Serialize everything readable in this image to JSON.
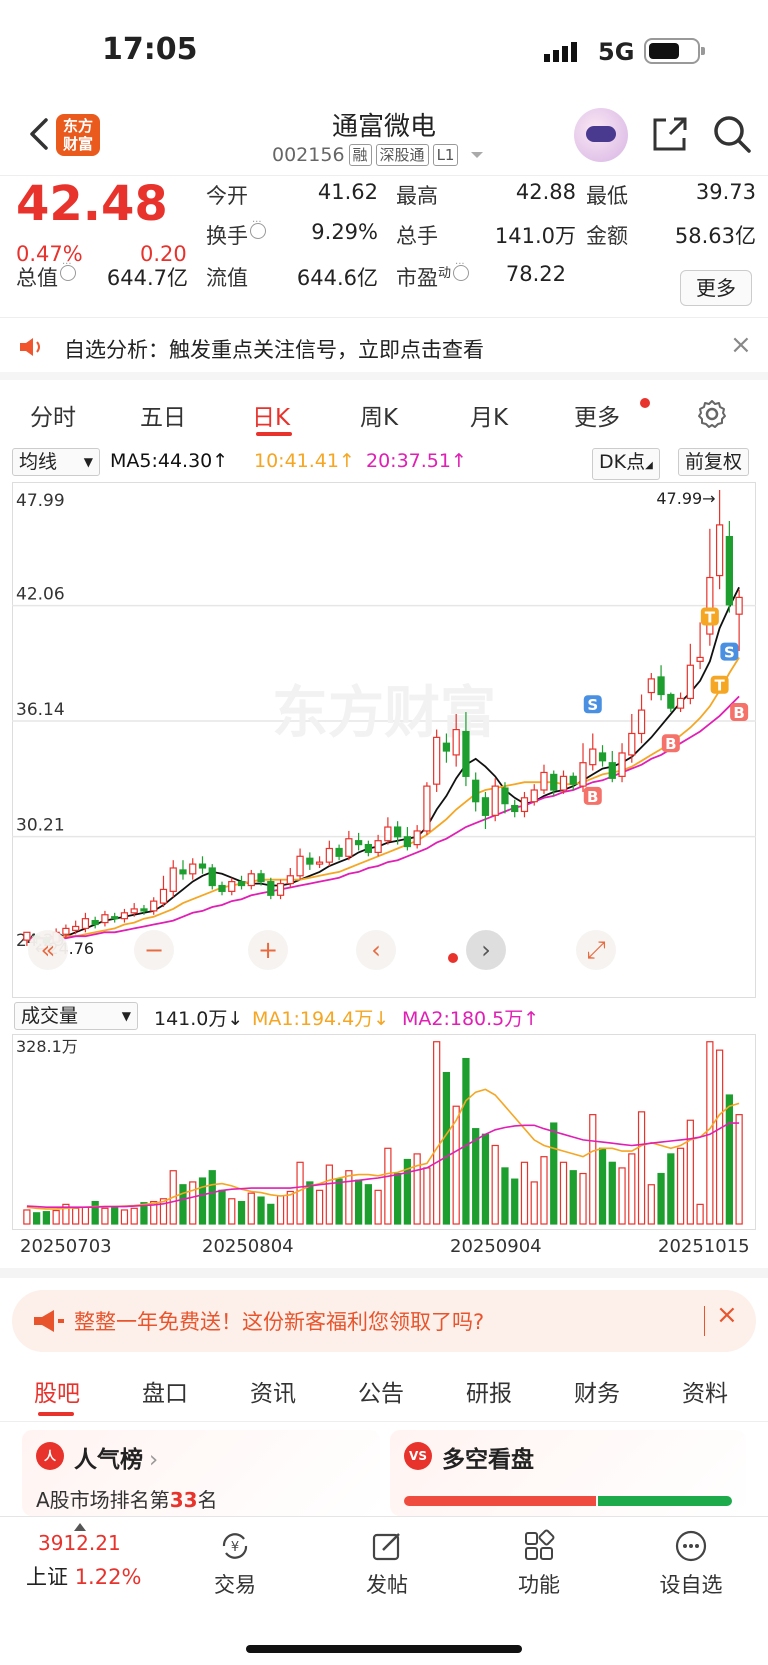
{
  "status": {
    "time": "17:05",
    "network": "5G"
  },
  "header": {
    "logo_text": "东方财富",
    "stock_name": "通富微电",
    "stock_code": "002156",
    "tags": [
      "融",
      "深股通",
      "L1"
    ]
  },
  "quote": {
    "price": "42.48",
    "change_pct": "0.47%",
    "change": "0.20",
    "fields": [
      {
        "label": "今开",
        "value": "41.62"
      },
      {
        "label": "最高",
        "value": "42.88"
      },
      {
        "label": "最低",
        "value": "39.73"
      },
      {
        "label": "换手",
        "value": "9.29%"
      },
      {
        "label": "总手",
        "value": "141.0万"
      },
      {
        "label": "金额",
        "value": "58.63亿"
      },
      {
        "label": "总值",
        "value": "644.7亿"
      },
      {
        "label": "流值",
        "value": "644.6亿"
      },
      {
        "label": "市盈",
        "label_sup": "动",
        "value": "78.22"
      }
    ],
    "more_label": "更多"
  },
  "alert": {
    "text": "自选分析：触发重点关注信号，立即点击查看",
    "close": "×"
  },
  "period_tabs": [
    "分时",
    "五日",
    "日K",
    "周K",
    "月K",
    "更多"
  ],
  "ma_row": {
    "selector": "均线",
    "ma5": "MA5:44.30↑",
    "ma10": "10:41.41↑",
    "ma20": "20:37.51↑",
    "dk": "DK点",
    "adjust": "前复权"
  },
  "colors": {
    "up": "#e8332d",
    "down": "#1d9e2f",
    "ma5": "#111111",
    "ma10": "#f5a623",
    "ma20": "#e01fb4",
    "signal_b": "#f4726a",
    "signal_s": "#4a90e2",
    "signal_t": "#f5a623"
  },
  "chart_data": [
    {
      "type": "candlestick",
      "y_ticks": [
        "47.99",
        "42.06",
        "36.14",
        "30.21",
        "24.29"
      ],
      "ylim": [
        24.29,
        47.99
      ],
      "high_label": "47.99→",
      "low_label": "←24.76",
      "watermark": "东方财富",
      "candles": [
        [
          24.9,
          25.3,
          24.6,
          25.1
        ],
        [
          25.1,
          25.0,
          24.7,
          25.2
        ],
        [
          25.0,
          24.76,
          24.76,
          25.1
        ],
        [
          24.8,
          25.3,
          24.8,
          25.5
        ],
        [
          25.2,
          25.5,
          25.0,
          25.7
        ],
        [
          25.4,
          25.6,
          25.2,
          25.9
        ],
        [
          25.5,
          26.0,
          25.3,
          26.3
        ],
        [
          25.9,
          25.7,
          25.5,
          26.1
        ],
        [
          25.8,
          26.2,
          25.6,
          26.4
        ],
        [
          26.1,
          26.0,
          25.8,
          26.3
        ],
        [
          26.0,
          26.3,
          25.8,
          26.5
        ],
        [
          26.3,
          26.5,
          26.1,
          26.8
        ],
        [
          26.5,
          26.4,
          26.2,
          26.7
        ],
        [
          26.4,
          26.9,
          26.2,
          27.1
        ],
        [
          26.8,
          27.5,
          26.6,
          28.2
        ],
        [
          27.4,
          28.6,
          27.1,
          29.0
        ],
        [
          28.5,
          28.3,
          28.0,
          29.0
        ],
        [
          28.3,
          28.8,
          28.0,
          29.1
        ],
        [
          28.8,
          28.6,
          28.3,
          29.2
        ],
        [
          28.6,
          27.7,
          27.5,
          28.8
        ],
        [
          27.7,
          27.4,
          27.2,
          27.9
        ],
        [
          27.4,
          27.9,
          27.2,
          28.1
        ],
        [
          27.9,
          27.7,
          27.5,
          28.2
        ],
        [
          27.7,
          28.3,
          27.5,
          28.5
        ],
        [
          28.3,
          27.9,
          27.7,
          28.5
        ],
        [
          27.9,
          27.2,
          27.0,
          28.1
        ],
        [
          27.2,
          27.8,
          27.0,
          28.0
        ],
        [
          27.8,
          28.2,
          27.6,
          28.6
        ],
        [
          28.2,
          29.2,
          28.0,
          29.6
        ],
        [
          29.1,
          28.8,
          28.5,
          29.4
        ],
        [
          28.8,
          28.9,
          28.6,
          29.2
        ],
        [
          28.9,
          29.6,
          28.7,
          30.0
        ],
        [
          29.6,
          29.2,
          29.0,
          29.8
        ],
        [
          29.2,
          30.1,
          29.0,
          30.5
        ],
        [
          30.0,
          29.8,
          29.5,
          30.4
        ],
        [
          29.8,
          29.4,
          29.2,
          30.0
        ],
        [
          29.4,
          30.0,
          29.2,
          30.3
        ],
        [
          30.0,
          30.7,
          29.8,
          31.2
        ],
        [
          30.7,
          30.2,
          29.8,
          31.0
        ],
        [
          30.2,
          29.7,
          29.5,
          30.7
        ],
        [
          29.8,
          30.5,
          29.6,
          30.8
        ],
        [
          30.5,
          32.8,
          30.3,
          33.0
        ],
        [
          32.9,
          35.3,
          32.5,
          35.7
        ],
        [
          35.0,
          34.6,
          34.0,
          35.5
        ],
        [
          34.4,
          35.7,
          33.8,
          36.5
        ],
        [
          35.6,
          33.3,
          32.8,
          36.6
        ],
        [
          33.1,
          32.0,
          31.5,
          33.5
        ],
        [
          32.2,
          31.3,
          30.6,
          32.5
        ],
        [
          31.3,
          32.8,
          31.0,
          33.2
        ],
        [
          32.7,
          31.9,
          31.4,
          33.0
        ],
        [
          31.8,
          31.5,
          31.2,
          32.1
        ],
        [
          31.5,
          32.2,
          31.2,
          32.5
        ],
        [
          32.0,
          32.6,
          31.8,
          32.9
        ],
        [
          32.6,
          33.5,
          32.4,
          33.9
        ],
        [
          33.4,
          32.6,
          32.3,
          33.6
        ],
        [
          32.6,
          33.3,
          32.4,
          33.6
        ],
        [
          33.3,
          32.9,
          32.6,
          33.5
        ],
        [
          32.8,
          34.0,
          32.5,
          35.0
        ],
        [
          33.9,
          34.7,
          33.6,
          35.5
        ],
        [
          34.5,
          34.1,
          33.8,
          34.9
        ],
        [
          34.0,
          33.2,
          33.0,
          34.6
        ],
        [
          33.3,
          34.5,
          33.0,
          35.0
        ],
        [
          34.4,
          35.5,
          34.0,
          36.5
        ],
        [
          35.5,
          36.7,
          35.0,
          37.5
        ],
        [
          37.6,
          38.3,
          37.2,
          38.6
        ],
        [
          38.4,
          37.5,
          37.2,
          39.0
        ],
        [
          37.5,
          36.8,
          36.6,
          37.6
        ],
        [
          36.8,
          37.3,
          36.6,
          37.6
        ],
        [
          37.3,
          39.0,
          37.0,
          40.1
        ],
        [
          39.2,
          39.4,
          38.8,
          41.2
        ],
        [
          40.6,
          43.5,
          40.0,
          46.0
        ],
        [
          43.6,
          46.2,
          42.9,
          47.99
        ],
        [
          45.6,
          42.1,
          41.7,
          46.4
        ],
        [
          41.62,
          42.48,
          39.73,
          42.88
        ]
      ],
      "ma5": [
        25.0,
        25.0,
        25.0,
        25.1,
        25.1,
        25.3,
        25.5,
        25.7,
        25.9,
        26.0,
        26.1,
        26.2,
        26.3,
        26.4,
        26.7,
        27.1,
        27.5,
        27.9,
        28.2,
        28.4,
        28.3,
        28.1,
        27.9,
        27.8,
        27.8,
        27.7,
        27.7,
        27.8,
        28.0,
        28.2,
        28.4,
        28.7,
        28.9,
        29.1,
        29.4,
        29.6,
        29.7,
        29.9,
        30.0,
        30.1,
        30.2,
        30.7,
        31.6,
        32.3,
        33.2,
        33.9,
        34.2,
        33.8,
        33.3,
        32.6,
        32.2,
        31.9,
        32.0,
        32.3,
        32.5,
        32.6,
        32.8,
        33.1,
        33.4,
        33.7,
        33.8,
        34.0,
        34.3,
        34.8,
        35.3,
        35.9,
        36.5,
        37.1,
        37.6,
        38.2,
        39.2,
        40.9,
        42.0,
        43.0
      ],
      "ma10": [
        25.0,
        25.0,
        25.0,
        25.0,
        25.1,
        25.1,
        25.2,
        25.3,
        25.4,
        25.5,
        25.7,
        25.8,
        26.0,
        26.1,
        26.3,
        26.5,
        26.8,
        27.0,
        27.2,
        27.4,
        27.6,
        27.7,
        27.8,
        27.9,
        28.0,
        28.0,
        28.0,
        28.0,
        28.0,
        28.1,
        28.2,
        28.3,
        28.4,
        28.6,
        28.8,
        29.0,
        29.2,
        29.4,
        29.6,
        29.8,
        30.0,
        30.3,
        30.7,
        31.1,
        31.6,
        32.0,
        32.4,
        32.6,
        32.7,
        32.8,
        32.9,
        33.0,
        33.0,
        33.0,
        33.0,
        32.9,
        32.9,
        33.0,
        33.2,
        33.4,
        33.5,
        33.6,
        33.8,
        34.1,
        34.4,
        34.7,
        35.0,
        35.4,
        35.8,
        36.3,
        36.9,
        37.7,
        38.6,
        39.4
      ],
      "ma20": [
        25.0,
        25.0,
        25.0,
        25.0,
        25.0,
        25.1,
        25.1,
        25.2,
        25.3,
        25.3,
        25.4,
        25.5,
        25.6,
        25.7,
        25.8,
        25.9,
        26.1,
        26.3,
        26.4,
        26.6,
        26.7,
        26.9,
        27.0,
        27.2,
        27.3,
        27.4,
        27.5,
        27.6,
        27.7,
        27.8,
        27.9,
        28.0,
        28.1,
        28.3,
        28.4,
        28.6,
        28.7,
        28.9,
        29.0,
        29.2,
        29.4,
        29.6,
        29.9,
        30.1,
        30.4,
        30.7,
        30.9,
        31.1,
        31.3,
        31.5,
        31.7,
        31.8,
        32.0,
        32.2,
        32.3,
        32.5,
        32.6,
        32.8,
        33.0,
        33.1,
        33.3,
        33.5,
        33.7,
        33.9,
        34.2,
        34.4,
        34.7,
        35.0,
        35.3,
        35.6,
        36.0,
        36.4,
        36.9,
        37.4
      ],
      "signals": [
        {
          "i": 58,
          "type": "B",
          "price": 32.3
        },
        {
          "i": 58,
          "type": "S",
          "price": 37.0
        },
        {
          "i": 66,
          "type": "B",
          "price": 35.0
        },
        {
          "i": 70,
          "type": "T",
          "price": 41.5
        },
        {
          "i": 71,
          "type": "T",
          "price": 38.0
        },
        {
          "i": 72,
          "type": "S",
          "price": 39.7
        },
        {
          "i": 73,
          "type": "B",
          "price": 36.6
        }
      ]
    },
    {
      "type": "volume",
      "title": "成交量",
      "max_label": "328.1万",
      "ylim": [
        0,
        328.1
      ],
      "volume": [
        25,
        20,
        22,
        24,
        35,
        28,
        30,
        40,
        28,
        30,
        25,
        28,
        38,
        40,
        45,
        95,
        70,
        75,
        82,
        95,
        60,
        45,
        40,
        55,
        48,
        35,
        50,
        58,
        110,
        75,
        60,
        105,
        80,
        95,
        78,
        70,
        60,
        135,
        90,
        115,
        125,
        100,
        325,
        270,
        210,
        295,
        170,
        160,
        140,
        100,
        80,
        110,
        75,
        120,
        180,
        110,
        95,
        90,
        195,
        135,
        110,
        100,
        125,
        200,
        70,
        90,
        125,
        135,
        185,
        35,
        325,
        310,
        230,
        195
      ],
      "vol_ma1": [
        30,
        28,
        27,
        27,
        28,
        29,
        30,
        31,
        31,
        31,
        32,
        33,
        35,
        37,
        40,
        48,
        55,
        60,
        66,
        70,
        72,
        68,
        62,
        58,
        56,
        52,
        50,
        52,
        60,
        68,
        72,
        78,
        82,
        86,
        88,
        88,
        86,
        90,
        92,
        98,
        104,
        108,
        135,
        160,
        185,
        220,
        235,
        240,
        230,
        210,
        190,
        170,
        150,
        140,
        135,
        130,
        125,
        120,
        130,
        135,
        135,
        130,
        130,
        140,
        145,
        140,
        135,
        140,
        150,
        155,
        170,
        195,
        210,
        215
      ],
      "vol_ma2": [
        32,
        31,
        30,
        30,
        30,
        30,
        30,
        30,
        31,
        31,
        31,
        32,
        33,
        34,
        36,
        40,
        44,
        48,
        52,
        56,
        60,
        62,
        63,
        64,
        64,
        64,
        64,
        64,
        66,
        68,
        70,
        72,
        74,
        76,
        78,
        80,
        82,
        85,
        88,
        92,
        96,
        100,
        110,
        120,
        130,
        140,
        150,
        160,
        168,
        172,
        175,
        176,
        176,
        170,
        165,
        160,
        155,
        150,
        148,
        146,
        144,
        142,
        140,
        142,
        144,
        146,
        148,
        150,
        152,
        155,
        160,
        170,
        180,
        180
      ]
    }
  ],
  "vol_row": {
    "selector": "成交量",
    "vol": "141.0万↓",
    "ma1": "MA1:194.4万↓",
    "ma2": "MA2:180.5万↑"
  },
  "dates": [
    "20250703",
    "20250804",
    "20250904",
    "20251015"
  ],
  "promo": {
    "text": "整整一年免费送！这份新客福利您领取了吗?",
    "close": "×"
  },
  "info_tabs": [
    "股吧",
    "盘口",
    "资讯",
    "公告",
    "研报",
    "财务",
    "资料"
  ],
  "cards": {
    "popularity": {
      "icon": "人",
      "title": "人气榜",
      "subtitle_prefix": "A股市场排名第",
      "rank": "33",
      "subtitle_suffix": "名"
    },
    "longshort": {
      "icon": "VS",
      "title": "多空看盘"
    }
  },
  "bottom_nav": {
    "index_value": "3912.21",
    "index_name": "上证",
    "index_pct": "1.22%",
    "items": [
      "交易",
      "发帖",
      "功能",
      "设自选"
    ]
  }
}
